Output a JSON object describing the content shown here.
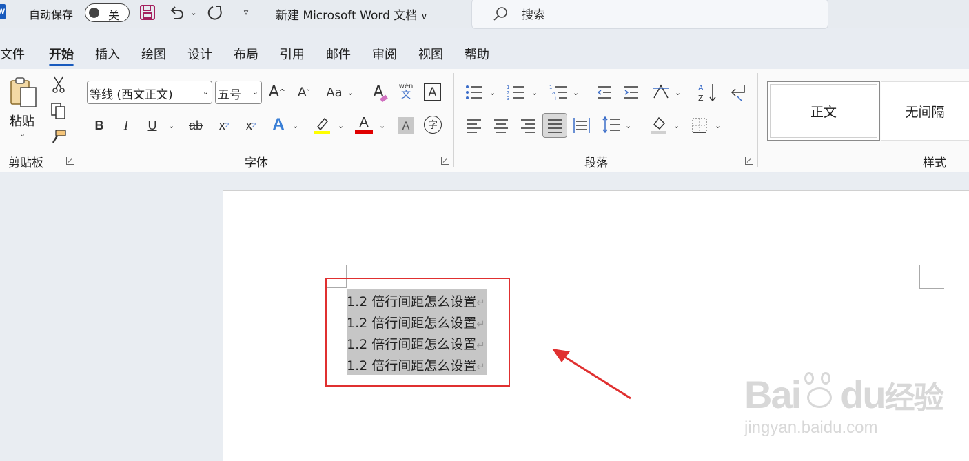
{
  "titlebar": {
    "autosave_label": "自动保存",
    "autosave_state": "关",
    "doc_title": "新建 Microsoft Word 文档",
    "search_placeholder": "搜索",
    "app_logo_letter": "W"
  },
  "menu": {
    "tabs": [
      {
        "label": "文件"
      },
      {
        "label": "开始",
        "active": true
      },
      {
        "label": "插入"
      },
      {
        "label": "绘图"
      },
      {
        "label": "设计"
      },
      {
        "label": "布局"
      },
      {
        "label": "引用"
      },
      {
        "label": "邮件"
      },
      {
        "label": "审阅"
      },
      {
        "label": "视图"
      },
      {
        "label": "帮助"
      }
    ]
  },
  "ribbon": {
    "clipboard": {
      "group_label": "剪贴板",
      "paste_label": "粘贴"
    },
    "font": {
      "group_label": "字体",
      "font_name": "等线 (西文正文)",
      "font_size": "五号",
      "bold": "B",
      "italic": "I",
      "underline": "U",
      "strike": "ab",
      "subscript": "x",
      "superscript": "x",
      "case_label": "Aa",
      "pinyin_top": "wén",
      "pinyin_bottom": "文",
      "charborder": "A",
      "enclose": "字",
      "grow": "A",
      "shrink": "A",
      "texteffect": "A",
      "fontcolor": "A",
      "shading": "A",
      "clear": "A"
    },
    "paragraph": {
      "group_label": "段落"
    },
    "styles": {
      "group_label": "样式",
      "items": [
        "正文",
        "无间隔"
      ]
    }
  },
  "document": {
    "lines": [
      "1.2 倍行间距怎么设置",
      "1.2 倍行间距怎么设置",
      "1.2 倍行间距怎么设置",
      "1.2 倍行间距怎么设置"
    ],
    "paragraph_mark": "↵"
  },
  "watermark": {
    "brand": "Bai",
    "brand2": "du",
    "brand_cn": "经验",
    "url": "jingyan.baidu.com"
  },
  "colors": {
    "accent": "#185abd",
    "highlight_yellow": "#ffff00",
    "font_red": "#e00000",
    "annotation_red": "#e03030",
    "selection_gray": "#c6c6c6"
  }
}
